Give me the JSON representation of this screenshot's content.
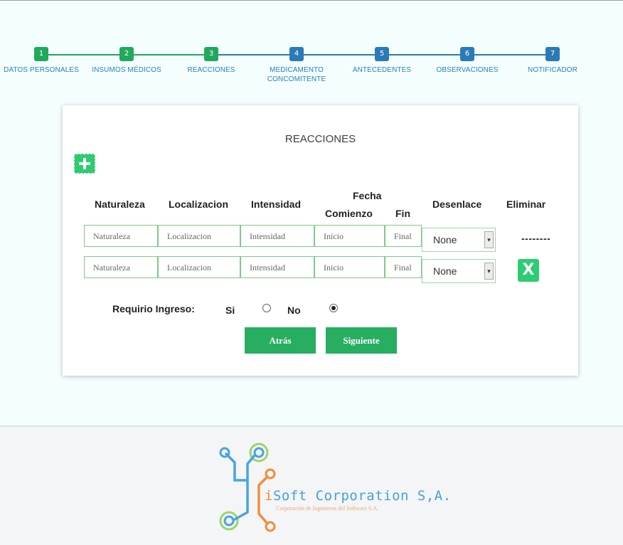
{
  "stepper": {
    "steps": [
      {
        "num": "1",
        "label": "DATOS PERSONALES"
      },
      {
        "num": "2",
        "label": "INSUMOS MÉDICOS"
      },
      {
        "num": "3",
        "label": "REACCIONES"
      },
      {
        "num": "4",
        "label": "MEDICAMENTO CONCOMITENTE"
      },
      {
        "num": "5",
        "label": "ANTECEDENTES"
      },
      {
        "num": "6",
        "label": "OBSERVACIONES"
      },
      {
        "num": "7",
        "label": "NOTIFICADOR"
      }
    ],
    "current_step": 3,
    "colors": {
      "done": "#21a95a",
      "todo": "#2a7ab8"
    }
  },
  "form": {
    "title": "REACCIONES",
    "add_icon": "plus-icon",
    "headers": {
      "naturaleza": "Naturaleza",
      "localizacion": "Localizacion",
      "intensidad": "Intensidad",
      "fecha": "Fecha",
      "comienzo": "Comienzo",
      "fin": "Fin",
      "desenlace": "Desenlace",
      "eliminar": "Eliminar"
    },
    "rows": [
      {
        "naturaleza": "Naturaleza",
        "localizacion": "Localizacion",
        "intensidad": "Intensidad",
        "inicio": "Inicio",
        "final": "Final",
        "desenlace": "None",
        "eliminar": "--------"
      },
      {
        "naturaleza": "Naturaleza",
        "localizacion": "Localizacion",
        "intensidad": "Intensidad",
        "inicio": "Inicio",
        "final": "Final",
        "desenlace": "None",
        "eliminar": "X"
      }
    ],
    "ingreso": {
      "label": "Requirio Ingreso:",
      "si": "Si",
      "no": "No",
      "selected": "No"
    },
    "buttons": {
      "back": "Atrás",
      "next": "Siguiente"
    },
    "accent": "#2ecc71"
  },
  "footer": {
    "brand_prefix": "i",
    "brand_rest": "Soft Corporation S,A.",
    "tagline": "Corporación de Ingenieros del Software S.A."
  }
}
